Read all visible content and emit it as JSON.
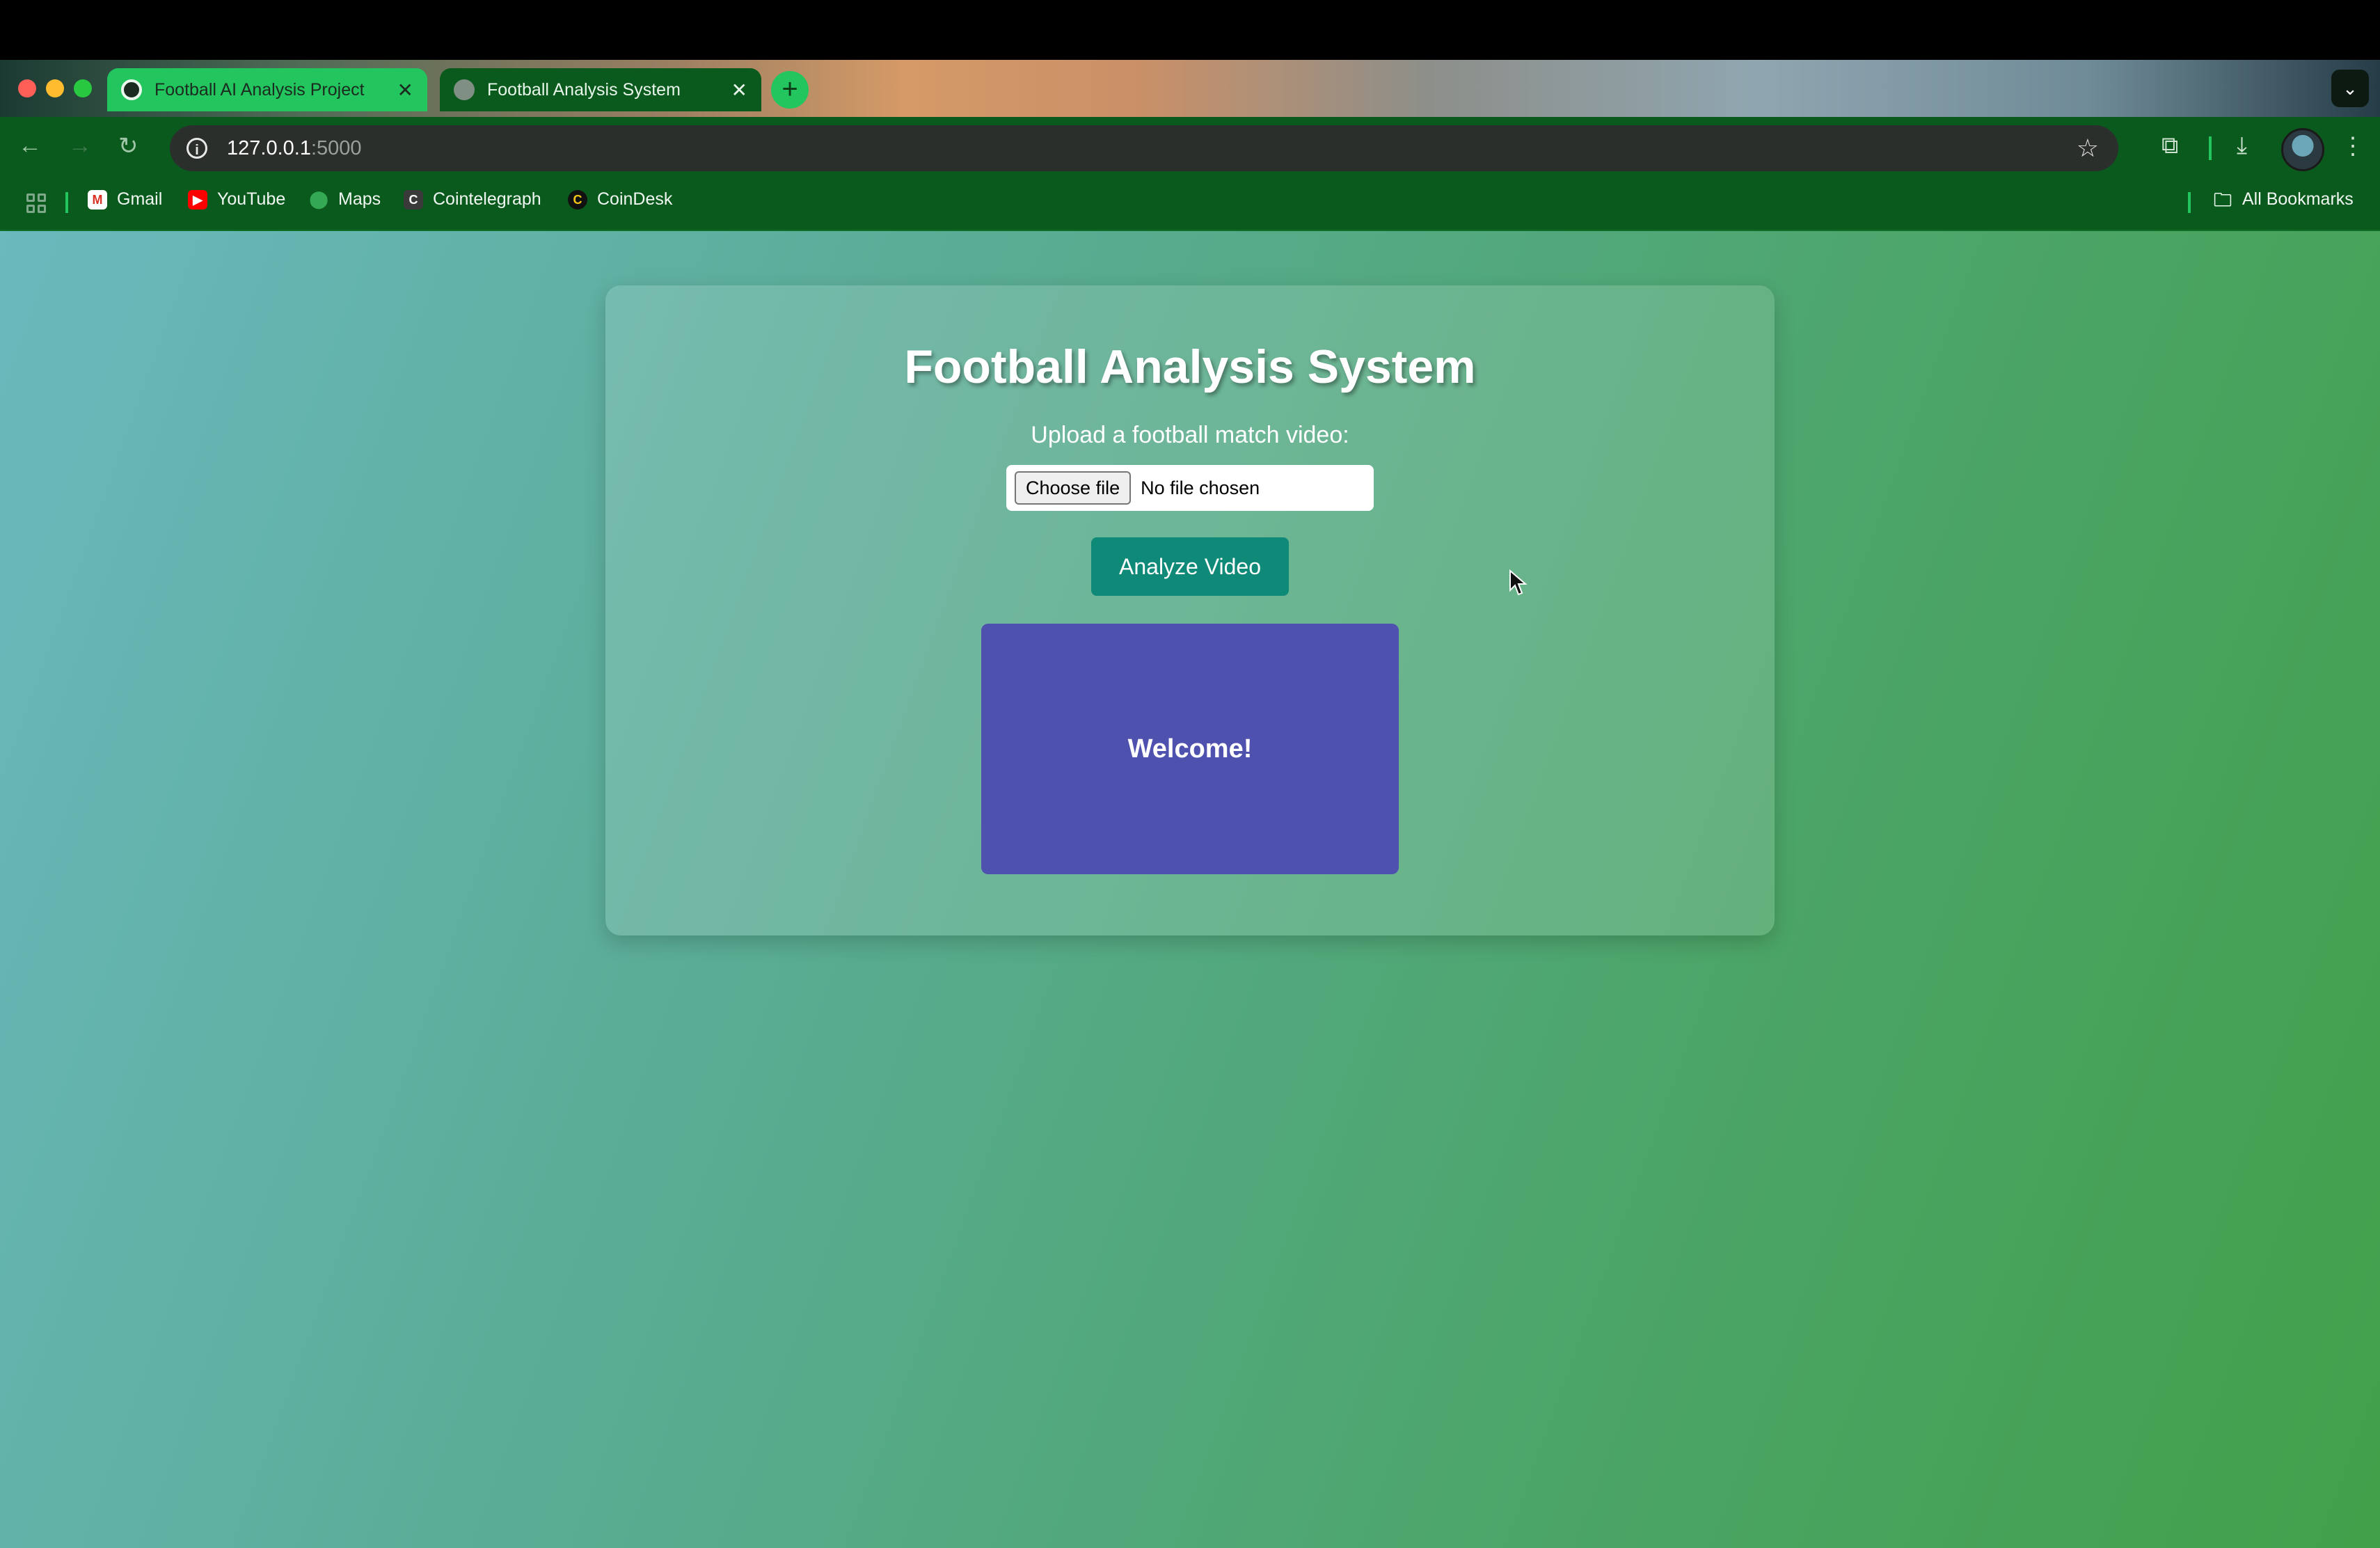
{
  "browser": {
    "tabs": [
      {
        "title": "Football AI Analysis Project",
        "active": false,
        "close": "✕"
      },
      {
        "title": "Football Analysis System",
        "active": true,
        "close": "✕"
      }
    ],
    "new_tab": "+",
    "tab_menu": "⌄",
    "address": {
      "host": "127.0.0.1",
      "port": ":5000"
    },
    "bookmarks": [
      {
        "label": "Gmail",
        "icon": "gmail-icon"
      },
      {
        "label": "YouTube",
        "icon": "youtube-icon"
      },
      {
        "label": "Maps",
        "icon": "maps-icon"
      },
      {
        "label": "Cointelegraph",
        "icon": "cointelegraph-icon"
      },
      {
        "label": "CoinDesk",
        "icon": "coindesk-icon"
      }
    ],
    "all_bookmarks": "All Bookmarks"
  },
  "page": {
    "title": "Football Analysis System",
    "upload_label": "Upload a football match video:",
    "choose_file": "Choose file",
    "no_file": "No file chosen",
    "analyze_button": "Analyze Video",
    "welcome": "Welcome!"
  },
  "colors": {
    "accent_green": "#22c55e",
    "toolbar_green": "#0a5a1d",
    "analyze_button": "#0f8a78",
    "welcome_box": "#4e51ad"
  }
}
